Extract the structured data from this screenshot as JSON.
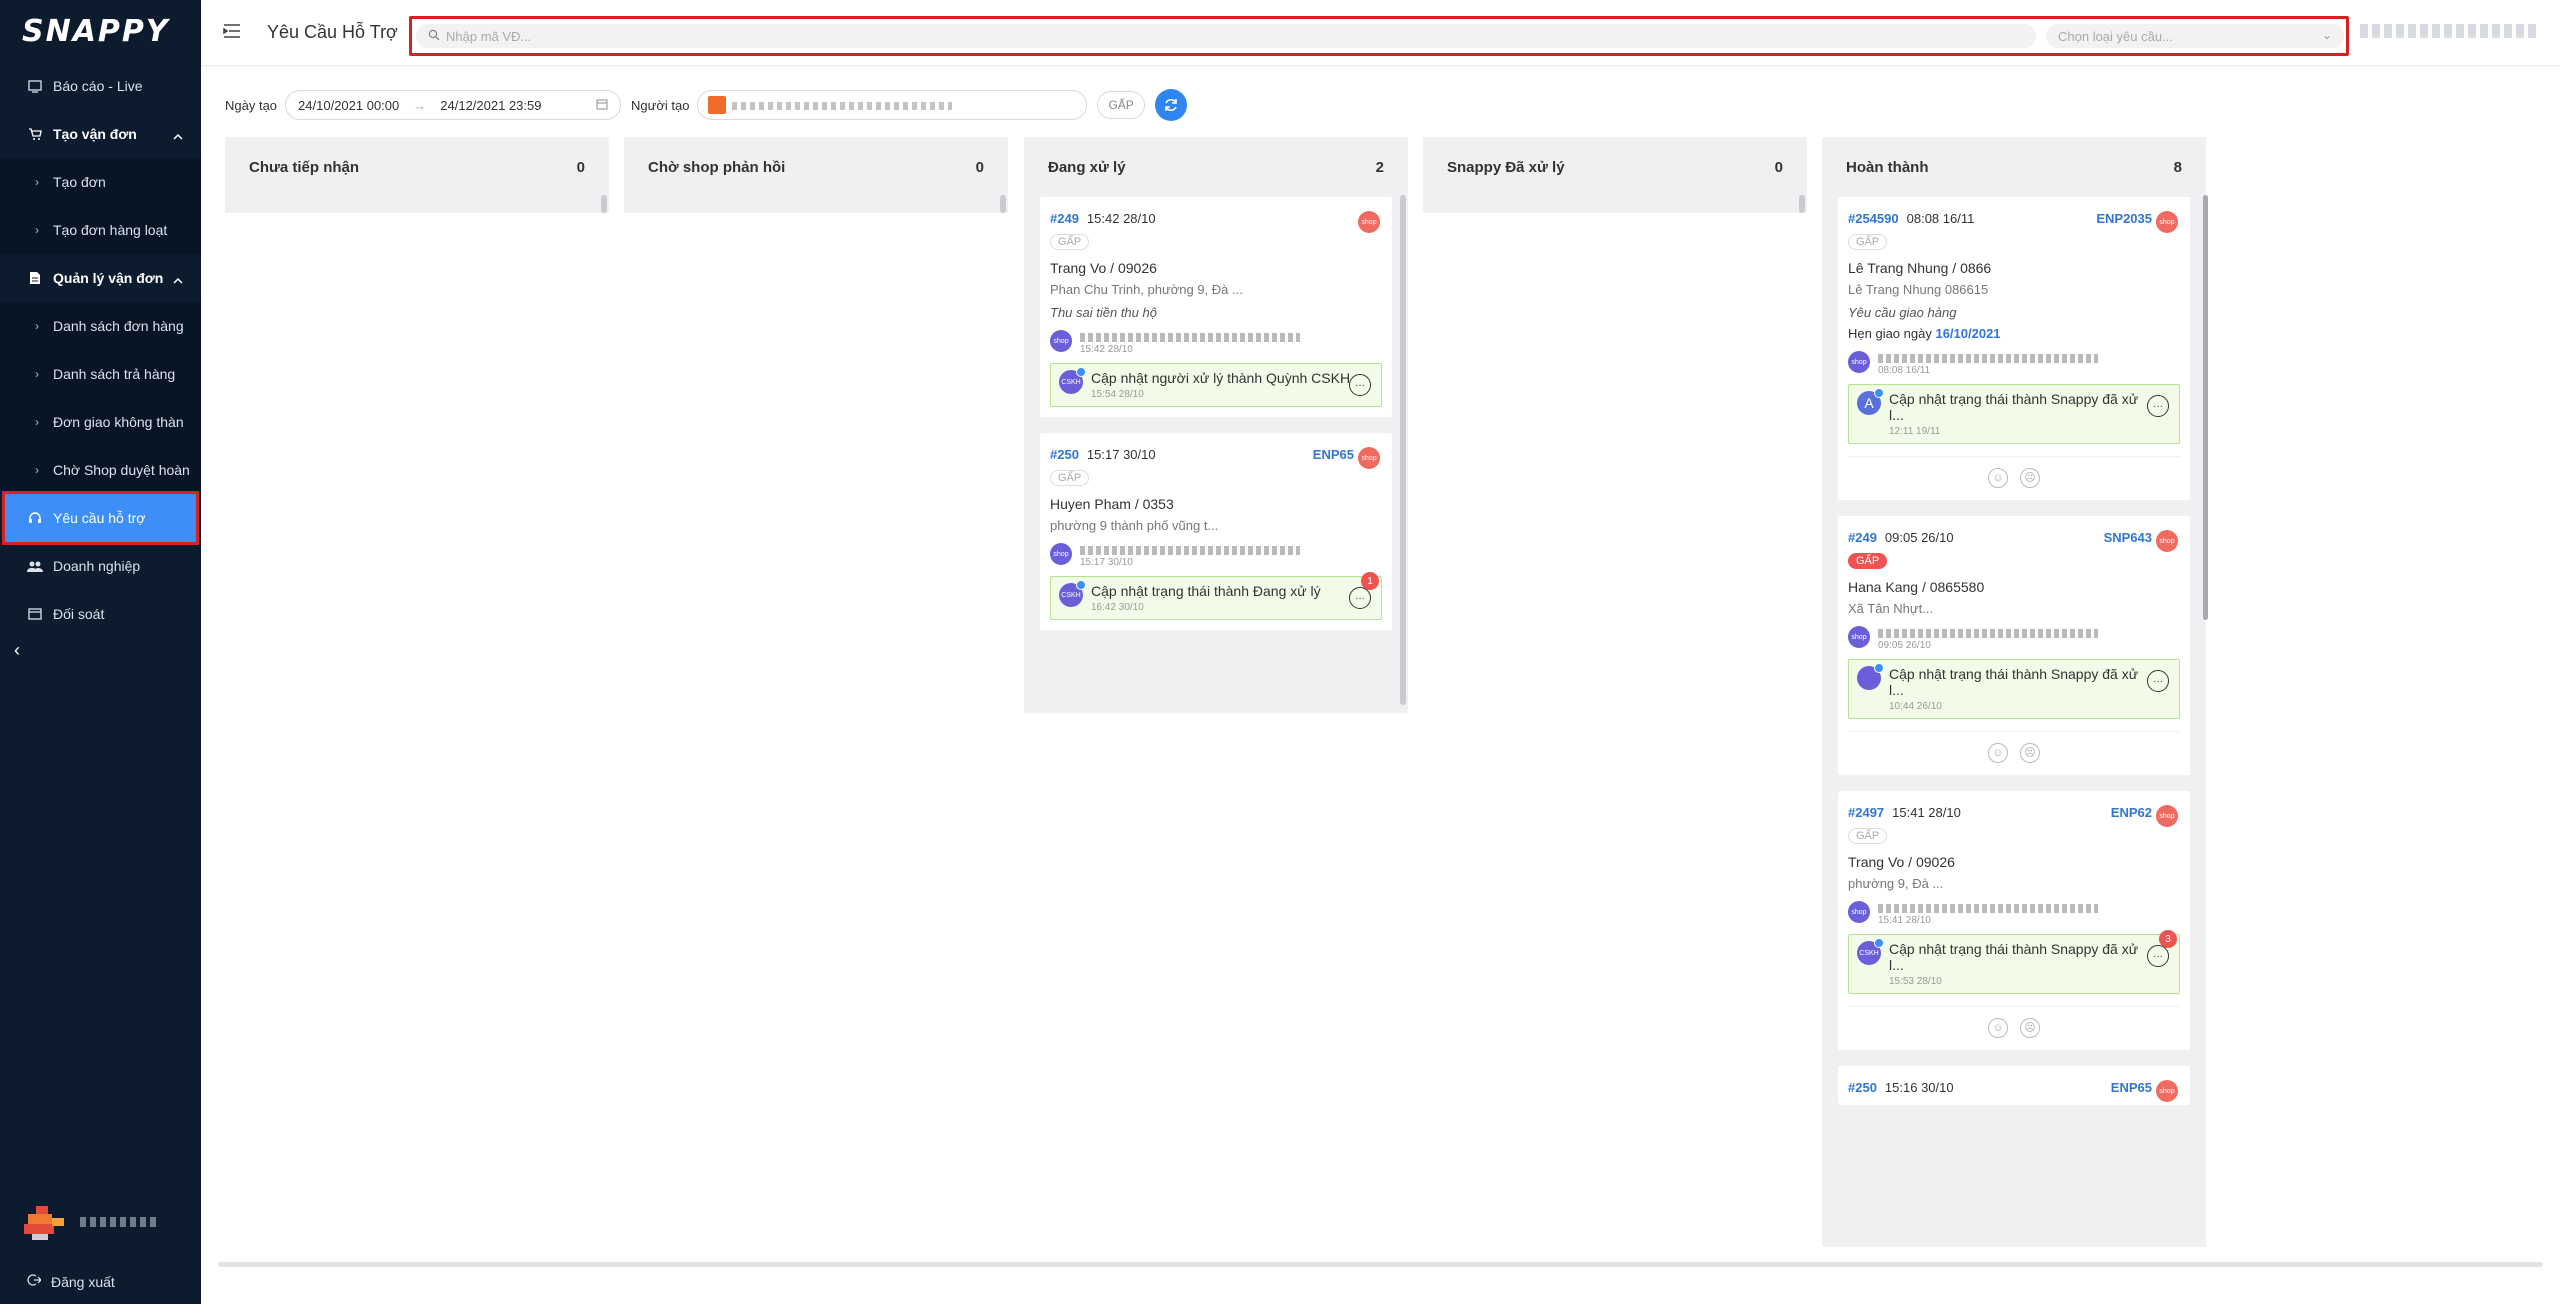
{
  "app": {
    "logo": "SNAPPY"
  },
  "sidebar": {
    "items": [
      {
        "label": "Báo cáo - Live"
      },
      {
        "label": "Tạo vận đơn"
      },
      {
        "label": "Tạo đơn"
      },
      {
        "label": "Tạo đơn hàng loạt"
      },
      {
        "label": "Quản lý vận đơn"
      },
      {
        "label": "Danh sách đơn hàng"
      },
      {
        "label": "Danh sách trả hàng"
      },
      {
        "label": "Đơn giao không thàn"
      },
      {
        "label": "Chờ Shop duyệt hoàn"
      },
      {
        "label": "Yêu cầu hỗ trợ"
      },
      {
        "label": "Doanh nghiệp"
      },
      {
        "label": "Đối soát"
      }
    ],
    "logout": "Đăng xuất"
  },
  "header": {
    "title": "Yêu Cầu Hỗ Trợ",
    "search_placeholder": "Nhập mã VĐ...",
    "type_placeholder": "Chọn loại yêu cầu..."
  },
  "filters": {
    "created_label": "Ngày tạo",
    "date_from": "24/10/2021 00:00",
    "date_to": "24/12/2021 23:59",
    "creator_label": "Người tạo",
    "urgent_label": "GẤP"
  },
  "columns": [
    {
      "title": "Chưa tiếp nhận",
      "count": "0"
    },
    {
      "title": "Chờ shop phản hồi",
      "count": "0"
    },
    {
      "title": "Đang xử lý",
      "count": "2"
    },
    {
      "title": "Snappy Đã xử lý",
      "count": "0"
    },
    {
      "title": "Hoàn thành",
      "count": "8"
    }
  ],
  "processing_cards": [
    {
      "code": "#249",
      "time": "15:42 28/10",
      "tag": "GẤP",
      "customer": "Trang Vo / 09026",
      "address": "Phan Chu Trinh, phường 9, Đà ...",
      "note": "Thu sai tiền thu hộ",
      "msg_time": "15:42 28/10",
      "update": "Cập nhật người xử lý thành Quỳnh CSKH",
      "update_time": "15:54 28/10"
    },
    {
      "code": "#250",
      "time": "15:17 30/10",
      "ref": "ENP65",
      "tag": "GẤP",
      "customer": "Huyen Pham / 0353",
      "address": "phường 9 thành phố vũng t...",
      "msg_time": "15:17 30/10",
      "update": "Cập nhật trạng thái thành Đang xử lý",
      "update_time": "16:42 30/10",
      "badge": "1"
    }
  ],
  "done_cards": [
    {
      "code": "#254590",
      "time": "08:08 16/11",
      "ref": "ENP2035",
      "tag": "GẤP",
      "customer": "Lê Trang Nhung / 0866",
      "address": "Lê Trang Nhung 086615",
      "note": "Yêu cầu giao hàng",
      "note2_label": "Hẹn giao ngày",
      "note2_value": "16/10/2021",
      "msg_time": "08:08 16/11",
      "update": "Cập nhật trạng thái thành Snappy đã xử l...",
      "update_time": "12:11 19/11"
    },
    {
      "code": "#249",
      "time": "09:05 26/10",
      "ref": "SNP643",
      "tag": "GẤP",
      "customer": "Hana Kang / 0865580",
      "address": "Xã Tân Nhựt...",
      "msg_time": "09:05 26/10",
      "update": "Cập nhật trạng thái thành Snappy đã xử l...",
      "update_time": "10:44 26/10"
    },
    {
      "code": "#2497",
      "time": "15:41 28/10",
      "ref": "ENP62",
      "tag": "GẤP",
      "customer": "Trang Vo / 09026",
      "address": "phường 9, Đà ...",
      "msg_time": "15:41 28/10",
      "update": "Cập nhật trạng thái thành Snappy đã xử l...",
      "update_time": "15:53 28/10",
      "badge": "3"
    },
    {
      "code": "#250",
      "time": "15:16 30/10",
      "ref": "ENP65"
    }
  ],
  "labels": {
    "shop": "shop",
    "cskh": "CSKH"
  }
}
